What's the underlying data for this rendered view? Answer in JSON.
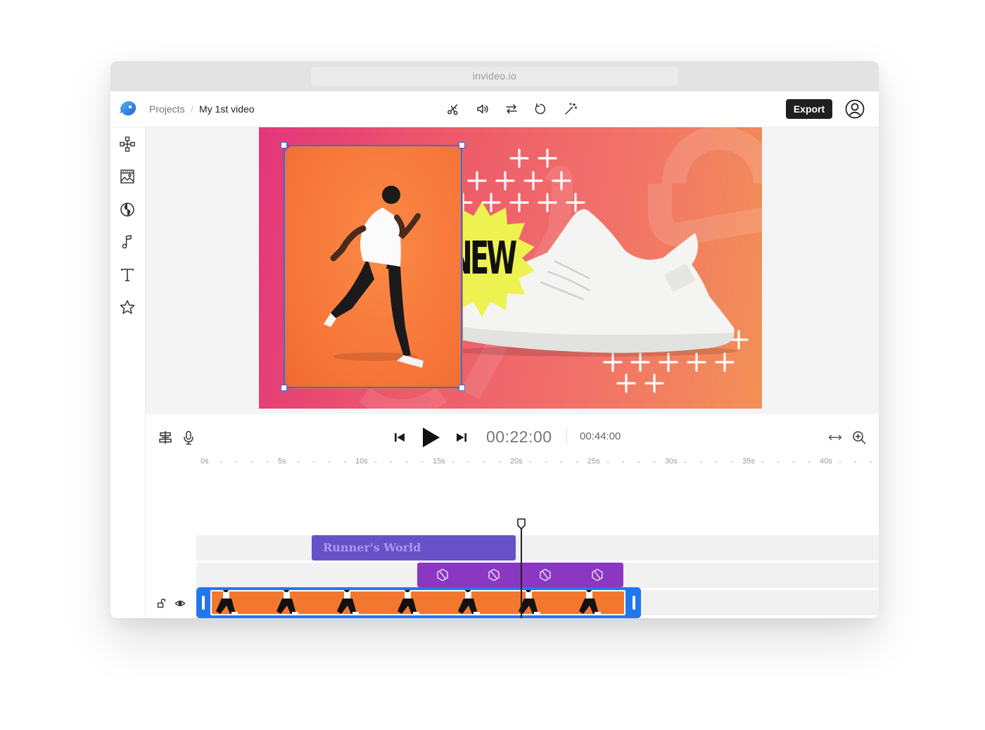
{
  "browser": {
    "url": "invideo.io"
  },
  "breadcrumb": {
    "projects": "Projects",
    "separator": "/",
    "current": "My 1st video"
  },
  "toolbar": {
    "tools": [
      "scissors-icon",
      "volume-icon",
      "swap-icon",
      "rotate-icon",
      "magic-wand-icon"
    ],
    "export_label": "Export"
  },
  "sidebar": {
    "items": [
      "elements-icon",
      "media-icon",
      "sticker-icon",
      "music-icon",
      "text-icon",
      "star-icon"
    ]
  },
  "preview": {
    "badge_text": "NEW"
  },
  "timeline": {
    "current_time": "00:22:00",
    "total_time": "00:44:00",
    "ruler_labels": [
      "0s",
      "5s",
      "10s",
      "15s",
      "20s",
      "25s",
      "30s",
      "35s",
      "40s"
    ],
    "text_clip_label": "Runner's World",
    "playhead_seconds": 20.5
  },
  "colors": {
    "accent_blue": "#2f6fe4",
    "text_clip": "#6652c6",
    "effect_clip": "#8a37c1",
    "video_clip": "#2277ee",
    "shoe_clip": "#1b2a45",
    "audio_clip": "#5ec96e"
  }
}
